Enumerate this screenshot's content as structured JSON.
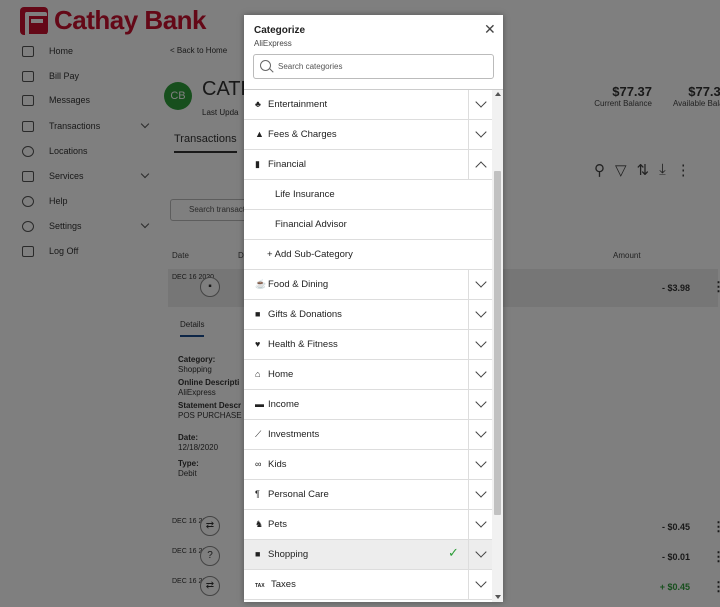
{
  "brand": {
    "name": "Cathay Bank",
    "color": "#c8102e"
  },
  "sidebar": {
    "items": [
      {
        "label": "Home",
        "icon": "home-icon"
      },
      {
        "label": "Bill Pay",
        "icon": "bill-pay-icon"
      },
      {
        "label": "Messages",
        "icon": "envelope-icon"
      },
      {
        "label": "Transactions",
        "icon": "card-icon",
        "has_submenu": true
      },
      {
        "label": "Locations",
        "icon": "location-pin-icon"
      },
      {
        "label": "Services",
        "icon": "services-icon",
        "has_submenu": true
      },
      {
        "label": "Help",
        "icon": "help-icon"
      },
      {
        "label": "Settings",
        "icon": "gear-icon",
        "has_submenu": true
      },
      {
        "label": "Log Off",
        "icon": "logout-icon"
      }
    ]
  },
  "main": {
    "back_link": "< Back to Home",
    "account": {
      "avatar": "CB",
      "name": "CATH",
      "updated": "Last Upda"
    },
    "balances": [
      {
        "amount": "$77.37",
        "label": "Current Balance"
      },
      {
        "amount": "$77.37",
        "label": "Available Balan"
      }
    ],
    "tab": "Transactions",
    "search_placeholder": "Search transacti",
    "columns": {
      "date": "Date",
      "desc": "D",
      "amount": "Amount"
    },
    "selected_row": {
      "date": "DEC 16 2020",
      "desc": "Ali",
      "sub": "Sh",
      "amount": "- $3.98"
    },
    "details": {
      "tab": "Details",
      "fields": [
        {
          "label": "Category:",
          "value": "Shopping"
        },
        {
          "label": "Online Descripti",
          "value": "AliExpress"
        },
        {
          "label": "Statement Descr",
          "value": "POS PURCHASE N"
        },
        {
          "label": "Date:",
          "value": "12/18/2020"
        },
        {
          "label": "Type:",
          "value": "Debit"
        }
      ]
    },
    "rows": [
      {
        "date": "DEC 16 2020",
        "desc": "Tra",
        "sub": "Tra",
        "amount": "- $0.45",
        "amount_color": "#333"
      },
      {
        "date": "DEC 16 2020",
        "desc": "Ca",
        "sub": "Unc",
        "amount": "- $0.01",
        "amount_color": "#333"
      },
      {
        "date": "DEC 16 2020",
        "desc": "Tra",
        "sub": "Tra",
        "amount": "+ $0.45",
        "amount_color": "#2e9e3a"
      }
    ]
  },
  "modal": {
    "title": "Categorize",
    "subtitle": "AliExpress",
    "search_placeholder": "Search categories",
    "categories": [
      {
        "label": "Entertainment",
        "icon": "entertainment-icon",
        "glyph": "♣"
      },
      {
        "label": "Fees & Charges",
        "icon": "warning-icon",
        "glyph": "▲"
      },
      {
        "label": "Financial",
        "icon": "bar-chart-icon",
        "glyph": "▮",
        "expanded": true,
        "subcategories": [
          "Life Insurance",
          "Financial Advisor"
        ],
        "add_label": "+ Add Sub-Category"
      },
      {
        "label": "Food & Dining",
        "icon": "food-icon",
        "glyph": "☕"
      },
      {
        "label": "Gifts & Donations",
        "icon": "gift-icon",
        "glyph": "■"
      },
      {
        "label": "Health & Fitness",
        "icon": "heartbeat-icon",
        "glyph": "♥"
      },
      {
        "label": "Home",
        "icon": "home-icon",
        "glyph": "⌂"
      },
      {
        "label": "Income",
        "icon": "briefcase-icon",
        "glyph": "▬"
      },
      {
        "label": "Investments",
        "icon": "line-chart-icon",
        "glyph": "⟋"
      },
      {
        "label": "Kids",
        "icon": "bicycle-icon",
        "glyph": "∞"
      },
      {
        "label": "Personal Care",
        "icon": "personal-care-icon",
        "glyph": "¶"
      },
      {
        "label": "Pets",
        "icon": "pet-icon",
        "glyph": "♞"
      },
      {
        "label": "Shopping",
        "icon": "shopping-bag-icon",
        "glyph": "■",
        "selected": true
      },
      {
        "label": "Taxes",
        "icon": "tax-icon",
        "glyph": "TAX"
      }
    ]
  }
}
